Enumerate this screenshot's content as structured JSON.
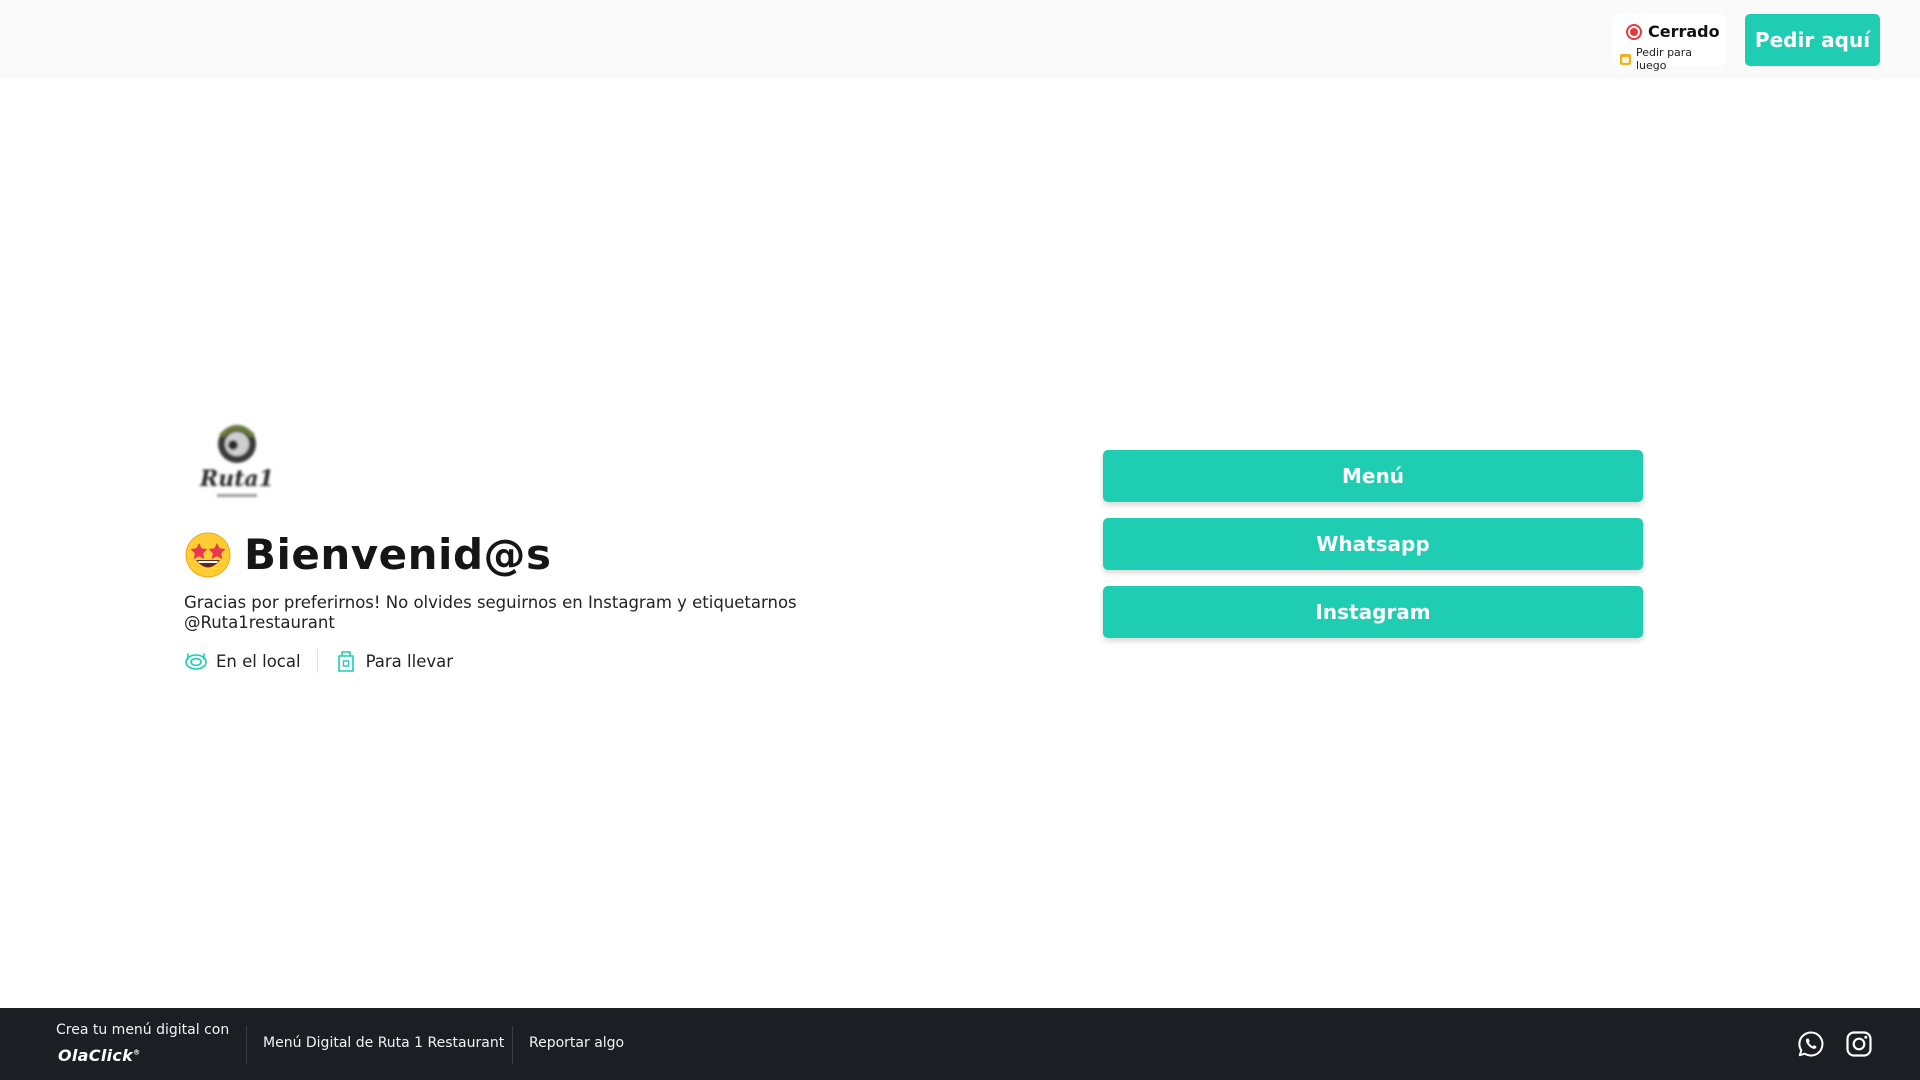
{
  "header": {
    "status": "Cerrado",
    "schedule_later": "Pedir para luego",
    "order_button": "Pedir aquí"
  },
  "hero": {
    "logo_alt": "Ruta 1 Restaurant logo",
    "emoji": "star-struck emoji",
    "title": "Bienvenid@s",
    "description": "Gracias por preferirnos! No olvides seguirnos en Instagram y etiquetarnos @Ruta1restaurant",
    "services": [
      {
        "label": "En el local",
        "icon": "dine-in-icon"
      },
      {
        "label": "Para llevar",
        "icon": "takeaway-bag-icon"
      }
    ]
  },
  "links": [
    {
      "label": "Menú"
    },
    {
      "label": "Whatsapp"
    },
    {
      "label": "Instagram"
    }
  ],
  "footer": {
    "create_text": "Crea tu menú digital con",
    "brand": "OlaClick",
    "menu_link": "Menú Digital de Ruta 1 Restaurant",
    "report_link": "Reportar algo",
    "social": [
      {
        "icon": "whatsapp-icon"
      },
      {
        "icon": "instagram-icon"
      }
    ]
  },
  "colors": {
    "accent": "#1ecdb2",
    "closed": "#e63b3b",
    "footer_bg": "#1b1f24",
    "header_bg": "#fafafa"
  }
}
